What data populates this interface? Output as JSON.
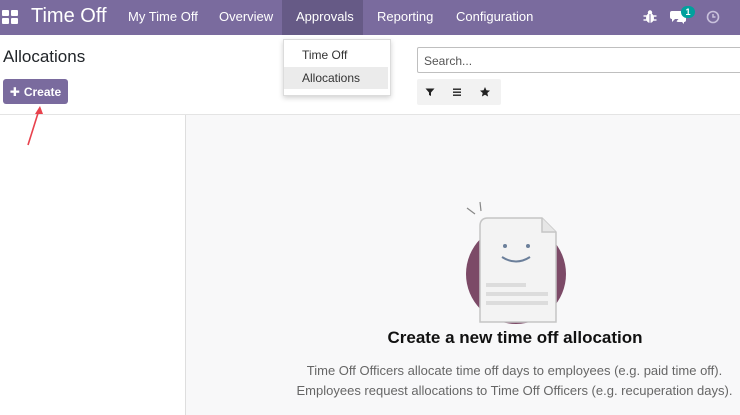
{
  "navbar": {
    "app_name": "Time Off",
    "menu": [
      {
        "label": "My Time Off"
      },
      {
        "label": "Overview"
      },
      {
        "label": "Approvals",
        "active": true
      },
      {
        "label": "Reporting"
      },
      {
        "label": "Configuration"
      }
    ],
    "chat_badge": "1",
    "icons": [
      "apps-grid-icon",
      "bug-icon",
      "chat-icon",
      "clock-icon"
    ],
    "brand_color": "#7a6b9e"
  },
  "dropdown": {
    "items": [
      {
        "label": "Time Off"
      },
      {
        "label": "Allocations",
        "selected": true
      }
    ]
  },
  "control_panel": {
    "title": "Allocations",
    "create_label": "Create",
    "search_placeholder": "Search...",
    "filter_icons": [
      "filter-icon",
      "group-by-icon",
      "favorites-star-icon"
    ]
  },
  "helper": {
    "title": "Create a new time off allocation",
    "line1": "Time Off Officers allocate time off days to employees (e.g. paid time off).",
    "line2": "Employees request allocations to Time Off Officers (e.g. recuperation days)."
  }
}
